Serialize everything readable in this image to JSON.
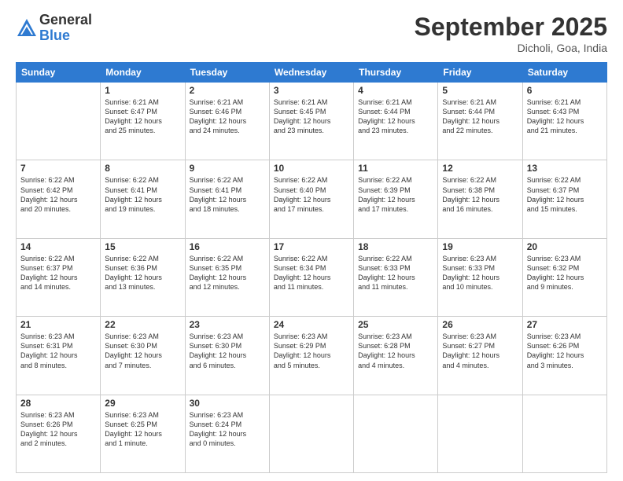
{
  "logo": {
    "general": "General",
    "blue": "Blue"
  },
  "header": {
    "month": "September 2025",
    "location": "Dicholi, Goa, India"
  },
  "weekdays": [
    "Sunday",
    "Monday",
    "Tuesday",
    "Wednesday",
    "Thursday",
    "Friday",
    "Saturday"
  ],
  "weeks": [
    [
      {
        "day": "",
        "content": ""
      },
      {
        "day": "1",
        "content": "Sunrise: 6:21 AM\nSunset: 6:47 PM\nDaylight: 12 hours\nand 25 minutes."
      },
      {
        "day": "2",
        "content": "Sunrise: 6:21 AM\nSunset: 6:46 PM\nDaylight: 12 hours\nand 24 minutes."
      },
      {
        "day": "3",
        "content": "Sunrise: 6:21 AM\nSunset: 6:45 PM\nDaylight: 12 hours\nand 23 minutes."
      },
      {
        "day": "4",
        "content": "Sunrise: 6:21 AM\nSunset: 6:44 PM\nDaylight: 12 hours\nand 23 minutes."
      },
      {
        "day": "5",
        "content": "Sunrise: 6:21 AM\nSunset: 6:44 PM\nDaylight: 12 hours\nand 22 minutes."
      },
      {
        "day": "6",
        "content": "Sunrise: 6:21 AM\nSunset: 6:43 PM\nDaylight: 12 hours\nand 21 minutes."
      }
    ],
    [
      {
        "day": "7",
        "content": "Sunrise: 6:22 AM\nSunset: 6:42 PM\nDaylight: 12 hours\nand 20 minutes."
      },
      {
        "day": "8",
        "content": "Sunrise: 6:22 AM\nSunset: 6:41 PM\nDaylight: 12 hours\nand 19 minutes."
      },
      {
        "day": "9",
        "content": "Sunrise: 6:22 AM\nSunset: 6:41 PM\nDaylight: 12 hours\nand 18 minutes."
      },
      {
        "day": "10",
        "content": "Sunrise: 6:22 AM\nSunset: 6:40 PM\nDaylight: 12 hours\nand 17 minutes."
      },
      {
        "day": "11",
        "content": "Sunrise: 6:22 AM\nSunset: 6:39 PM\nDaylight: 12 hours\nand 17 minutes."
      },
      {
        "day": "12",
        "content": "Sunrise: 6:22 AM\nSunset: 6:38 PM\nDaylight: 12 hours\nand 16 minutes."
      },
      {
        "day": "13",
        "content": "Sunrise: 6:22 AM\nSunset: 6:37 PM\nDaylight: 12 hours\nand 15 minutes."
      }
    ],
    [
      {
        "day": "14",
        "content": "Sunrise: 6:22 AM\nSunset: 6:37 PM\nDaylight: 12 hours\nand 14 minutes."
      },
      {
        "day": "15",
        "content": "Sunrise: 6:22 AM\nSunset: 6:36 PM\nDaylight: 12 hours\nand 13 minutes."
      },
      {
        "day": "16",
        "content": "Sunrise: 6:22 AM\nSunset: 6:35 PM\nDaylight: 12 hours\nand 12 minutes."
      },
      {
        "day": "17",
        "content": "Sunrise: 6:22 AM\nSunset: 6:34 PM\nDaylight: 12 hours\nand 11 minutes."
      },
      {
        "day": "18",
        "content": "Sunrise: 6:22 AM\nSunset: 6:33 PM\nDaylight: 12 hours\nand 11 minutes."
      },
      {
        "day": "19",
        "content": "Sunrise: 6:23 AM\nSunset: 6:33 PM\nDaylight: 12 hours\nand 10 minutes."
      },
      {
        "day": "20",
        "content": "Sunrise: 6:23 AM\nSunset: 6:32 PM\nDaylight: 12 hours\nand 9 minutes."
      }
    ],
    [
      {
        "day": "21",
        "content": "Sunrise: 6:23 AM\nSunset: 6:31 PM\nDaylight: 12 hours\nand 8 minutes."
      },
      {
        "day": "22",
        "content": "Sunrise: 6:23 AM\nSunset: 6:30 PM\nDaylight: 12 hours\nand 7 minutes."
      },
      {
        "day": "23",
        "content": "Sunrise: 6:23 AM\nSunset: 6:30 PM\nDaylight: 12 hours\nand 6 minutes."
      },
      {
        "day": "24",
        "content": "Sunrise: 6:23 AM\nSunset: 6:29 PM\nDaylight: 12 hours\nand 5 minutes."
      },
      {
        "day": "25",
        "content": "Sunrise: 6:23 AM\nSunset: 6:28 PM\nDaylight: 12 hours\nand 4 minutes."
      },
      {
        "day": "26",
        "content": "Sunrise: 6:23 AM\nSunset: 6:27 PM\nDaylight: 12 hours\nand 4 minutes."
      },
      {
        "day": "27",
        "content": "Sunrise: 6:23 AM\nSunset: 6:26 PM\nDaylight: 12 hours\nand 3 minutes."
      }
    ],
    [
      {
        "day": "28",
        "content": "Sunrise: 6:23 AM\nSunset: 6:26 PM\nDaylight: 12 hours\nand 2 minutes."
      },
      {
        "day": "29",
        "content": "Sunrise: 6:23 AM\nSunset: 6:25 PM\nDaylight: 12 hours\nand 1 minute."
      },
      {
        "day": "30",
        "content": "Sunrise: 6:23 AM\nSunset: 6:24 PM\nDaylight: 12 hours\nand 0 minutes."
      },
      {
        "day": "",
        "content": ""
      },
      {
        "day": "",
        "content": ""
      },
      {
        "day": "",
        "content": ""
      },
      {
        "day": "",
        "content": ""
      }
    ]
  ]
}
